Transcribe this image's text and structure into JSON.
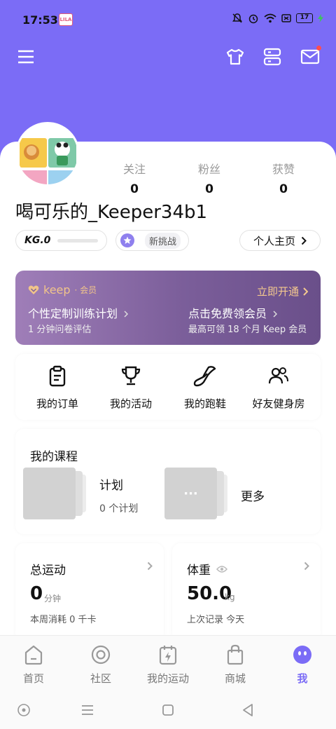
{
  "status_bar": {
    "time": "17:53",
    "app_icon_text": "LILA",
    "battery": "17"
  },
  "header": {
    "menu_icon": "menu-icon",
    "shirt_icon": "tshirt-icon",
    "server_icon": "storage-icon",
    "mail_icon": "mail-icon"
  },
  "profile": {
    "stats": [
      {
        "label": "关注",
        "value": "0"
      },
      {
        "label": "粉丝",
        "value": "0"
      },
      {
        "label": "获赞",
        "value": "0"
      }
    ],
    "username": "喝可乐的_Keeper34b1",
    "kg_level": "KG.0",
    "challenge_label": "新挑战",
    "homepage_label": "个人主页"
  },
  "vip": {
    "brand": "keep",
    "member_tag": "· 会员",
    "open_label": "立即开通",
    "plan_title": "个性定制训练计划",
    "plan_sub": "1 分钟问卷评估",
    "free_title": "点击免费领会员",
    "free_sub": "最高可领 18 个月 Keep 会员"
  },
  "actions": [
    {
      "label": "我的订单",
      "icon": "clipboard-icon"
    },
    {
      "label": "我的活动",
      "icon": "trophy-icon"
    },
    {
      "label": "我的跑鞋",
      "icon": "shoe-icon"
    },
    {
      "label": "好友健身房",
      "icon": "friends-icon"
    }
  ],
  "courses": {
    "title": "我的课程",
    "plan_label": "计划",
    "plan_count": "0 个计划",
    "more_dots": "···",
    "more_label": "更多"
  },
  "total_exercise": {
    "title": "总运动",
    "value": "0",
    "unit": "分钟",
    "sub": "本周消耗 0 千卡"
  },
  "weight": {
    "title": "体重",
    "value": "50.0",
    "unit": "kg",
    "sub": "上次记录 今天"
  },
  "bottom_nav": [
    {
      "label": "首页",
      "icon": "home-icon",
      "active": false
    },
    {
      "label": "社区",
      "icon": "community-icon",
      "active": false
    },
    {
      "label": "我的运动",
      "icon": "calendar-bolt-icon",
      "active": false
    },
    {
      "label": "商城",
      "icon": "shopping-bag-icon",
      "active": false
    },
    {
      "label": "我",
      "icon": "profile-face-icon",
      "active": true
    }
  ],
  "colors": {
    "brand": "#7b6cf6",
    "vip_gold": "#f4c98e",
    "vip_bg": "#7b5e9a"
  }
}
